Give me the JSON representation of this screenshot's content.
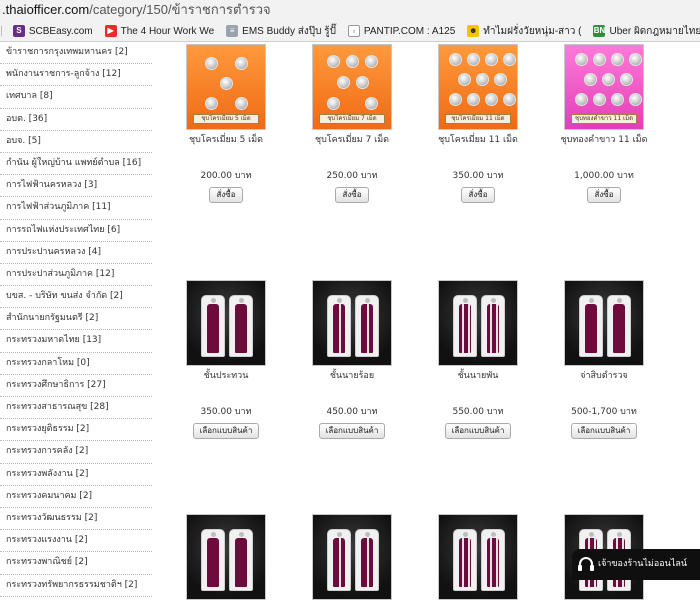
{
  "browser": {
    "url_host": ".thaiofficer.com",
    "url_path": "/category/150/ข้าราชการตำรวจ",
    "bookmarks": [
      {
        "label": "SCBEasy.com",
        "icon": "scb-icon",
        "color": "#6a2c8c",
        "glyph": "S"
      },
      {
        "label": "The 4 Hour Work We",
        "icon": "youtube-icon",
        "color": "#e52d27",
        "glyph": "▶"
      },
      {
        "label": "EMS Buddy ส่งปุ๊บ รู้ปั๊",
        "icon": "document-icon",
        "color": "#9aa3ad",
        "glyph": "≡"
      },
      {
        "label": "PANTIP.COM : A125",
        "icon": "page-icon",
        "color": "#ffffff",
        "glyph": "▫"
      },
      {
        "label": "ทำไมฝรั่งวัยหนุ่ม-สาว (",
        "icon": "emoji-icon",
        "color": "#f7c400",
        "glyph": "☻"
      },
      {
        "label": "Uber ผิดกฎหมายไทย",
        "icon": "bn-icon",
        "color": "#2f8f3a",
        "glyph": "BN"
      }
    ]
  },
  "sidebar": {
    "items": [
      "ข้าราชการกรุงเทพมหานคร [2]",
      "พนักงานราชการ-ลูกจ้าง [12]",
      "เทศบาล [8]",
      "อบต. [36]",
      "อบจ. [5]",
      "กำนัน ผู้ใหญ่บ้าน แพทย์ตำบล [16]",
      "การไฟฟ้านครหลวง [3]",
      "การไฟฟ้าส่วนภูมิภาค [11]",
      "การรถไฟแห่งประเทศไทย [6]",
      "การประปานครหลวง [4]",
      "การประปาส่วนภูมิภาค [12]",
      "บขส. - บริษัท ขนส่ง จำกัด [2]",
      "สำนักนายกรัฐมนตรี [2]",
      "กระทรวงมหาดไทย [13]",
      "กระทรวงกลาโหม [0]",
      "กระทรวงศึกษาธิการ [27]",
      "กระทรวงสาธารณสุข [28]",
      "กระทรวงยุติธรรม [2]",
      "กระทรวงการคลัง [2]",
      "กระทรวงพลังงาน [2]",
      "กระทรวงคมนาคม [2]",
      "กระทรวงวัฒนธรรม [2]",
      "กระทรวงแรงงาน [2]",
      "กระทรวงพาณิชย์ [2]",
      "กระทรวงทรัพยากรธรรมชาติฯ [2]"
    ]
  },
  "products": [
    {
      "title": "ชุบโครเมี่ยม 5 เม็ด",
      "price": "200.00 บาท",
      "button": "สั่งซื้อ",
      "image": "orange",
      "caption": "ชุบโครเมี่ยม 5 เม็ด",
      "coins": 5
    },
    {
      "title": "ชุบโครเมี่ยม 7 เม็ด",
      "price": "250.00 บาท",
      "button": "สั่งซื้อ",
      "image": "orange",
      "caption": "ชุบโครเมี่ยม 7 เม็ด",
      "coins": 7
    },
    {
      "title": "ชุบโครเมี่ยม 11 เม็ด",
      "price": "350.00 บาท",
      "button": "สั่งซื้อ",
      "image": "orange",
      "caption": "ชุบโครเมี่ยม 11 เม็ด",
      "coins": 11
    },
    {
      "title": "ชุบทองคำขาว 11 เม็ด",
      "price": "1,000.00 บาท",
      "button": "สั่งซื้อ",
      "image": "pink",
      "caption": "ชุบทองคำขาว 11 เม็ด",
      "coins": 11
    },
    {
      "title": "ชั้นประทวน",
      "price": "350.00 บาท",
      "button": "เลือกแบบสินค้า",
      "image": "dark",
      "stripes": 0
    },
    {
      "title": "ชั้นนายร้อย",
      "price": "450.00 บาท",
      "button": "เลือกแบบสินค้า",
      "image": "dark",
      "stripes": 1
    },
    {
      "title": "ชั้นนายพัน",
      "price": "550.00 บาท",
      "button": "เลือกแบบสินค้า",
      "image": "dark",
      "stripes": 2
    },
    {
      "title": "จ่าสิบตำรวจ",
      "price": "500-1,700 บาท",
      "button": "เลือกแบบสินค้า",
      "image": "dark",
      "stripes": 0
    },
    {
      "title": "",
      "price": "",
      "button": "",
      "image": "dark",
      "stripes": 0
    },
    {
      "title": "",
      "price": "",
      "button": "",
      "image": "dark",
      "stripes": 1
    },
    {
      "title": "",
      "price": "",
      "button": "",
      "image": "dark",
      "stripes": 2
    },
    {
      "title": "",
      "price": "",
      "button": "",
      "image": "dark",
      "stripes": 2
    }
  ],
  "chat": {
    "label": "เจ้าของร้านไม่ออนไลน์"
  }
}
